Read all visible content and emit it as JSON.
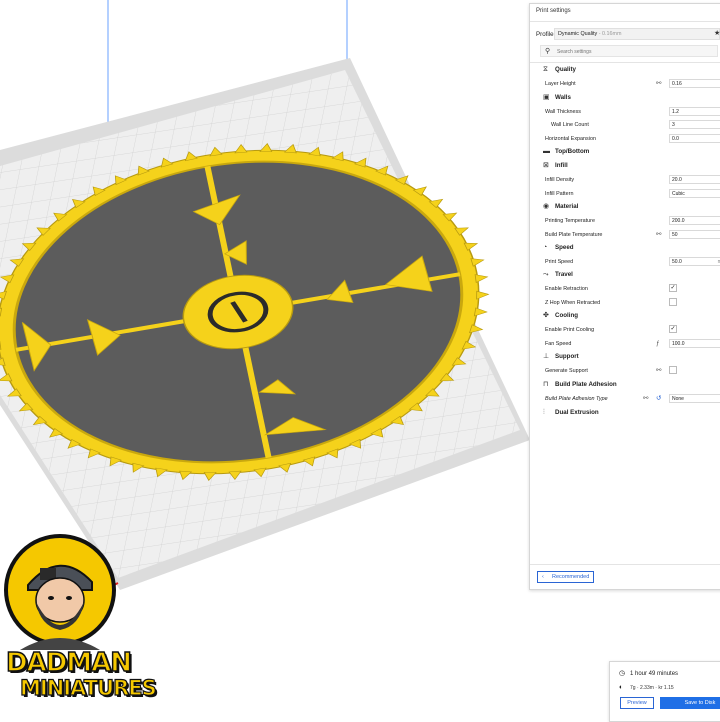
{
  "panel": {
    "title": "Print settings",
    "profile_label": "Profile",
    "profile_value": "Dynamic Quality",
    "profile_sub": " - 0.16mm",
    "search_placeholder": "Search settings"
  },
  "categories": {
    "quality": "Quality",
    "walls": "Walls",
    "top_bottom": "Top/Bottom",
    "infill": "Infill",
    "material": "Material",
    "speed": "Speed",
    "travel": "Travel",
    "cooling": "Cooling",
    "support": "Support",
    "adhesion": "Build Plate Adhesion",
    "dual": "Dual Extrusion"
  },
  "settings": {
    "layer_height": {
      "label": "Layer Height",
      "value": "0.16"
    },
    "wall_thickness": {
      "label": "Wall Thickness",
      "value": "1.2"
    },
    "wall_line_count": {
      "label": "Wall Line Count",
      "value": "3"
    },
    "horizontal_expansion": {
      "label": "Horizontal Expansion",
      "value": "0.0"
    },
    "infill_density": {
      "label": "Infill Density",
      "value": "20.0"
    },
    "infill_pattern": {
      "label": "Infill Pattern",
      "value": "Cubic"
    },
    "printing_temperature": {
      "label": "Printing Temperature",
      "value": "200.0"
    },
    "build_plate_temperature": {
      "label": "Build Plate Temperature",
      "value": "50"
    },
    "print_speed": {
      "label": "Print Speed",
      "value": "50.0",
      "unit": "mm"
    },
    "enable_retraction": {
      "label": "Enable Retraction",
      "checked": true
    },
    "z_hop": {
      "label": "Z Hop When Retracted",
      "checked": false
    },
    "enable_cooling": {
      "label": "Enable Print Cooling",
      "checked": true
    },
    "fan_speed": {
      "label": "Fan Speed",
      "value": "100.0"
    },
    "generate_support": {
      "label": "Generate Support",
      "checked": false
    },
    "adhesion_type": {
      "label": "Build Plate Adhesion Type",
      "value": "None"
    }
  },
  "recommended_label": "Recommended",
  "estimate": {
    "time": "1 hour 49 minutes",
    "material": "7g · 2.33m · kr 1.15",
    "preview_label": "Preview",
    "save_label": "Save to Disk"
  },
  "logo": {
    "line1": "DADMAN",
    "line2": "MINIATURES"
  },
  "colors": {
    "model_yellow": "#f5d21b",
    "model_dark": "#5a5a5a",
    "bed": "#e9e9e9",
    "accent_blue": "#1f6fe6"
  }
}
